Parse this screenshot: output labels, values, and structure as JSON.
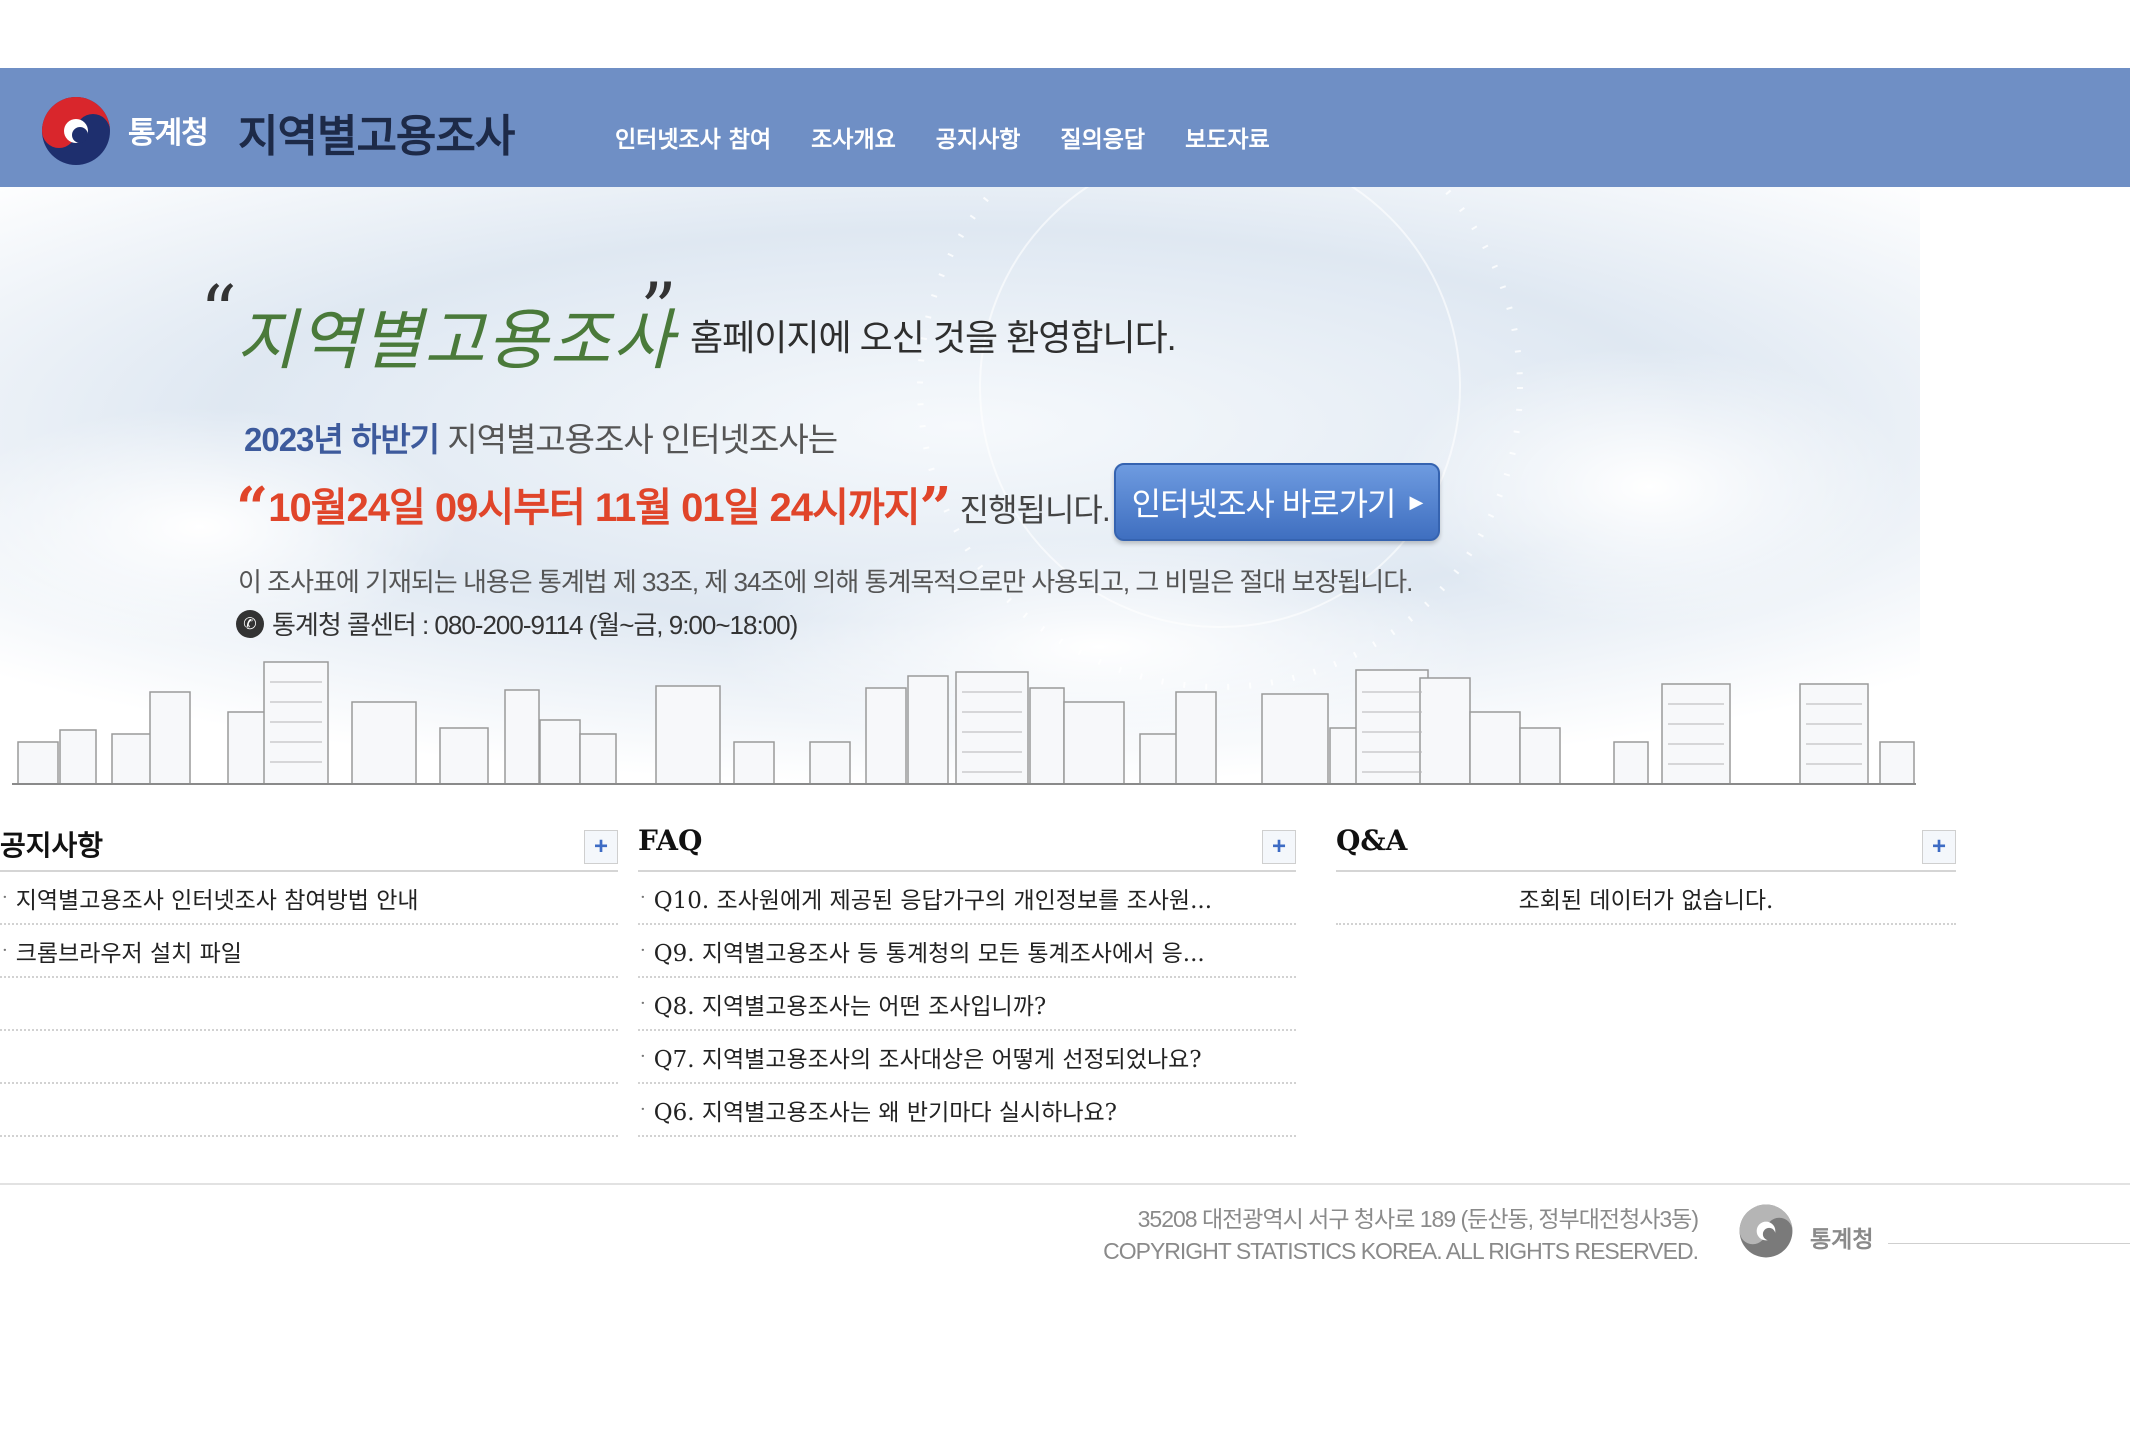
{
  "header": {
    "org_name": "통계청",
    "site_title": "지역별고용조사",
    "nav": [
      "인터넷조사 참여",
      "조사개요",
      "공지사항",
      "질의응답",
      "보도자료"
    ]
  },
  "banner": {
    "welcome_brand": "지역별고용조사",
    "welcome_text": "홈페이지에 오신 것을 환영합니다.",
    "period_year": "2023년",
    "period_half": "하반기",
    "period_rest": "지역별고용조사 인터넷조사는",
    "period_dates": "10월24일 09시부터  11월 01일 24시까지",
    "period_suffix": "진행됩니다.",
    "cta_label": "인터넷조사 바로가기",
    "legal": "이 조사표에 기재되는 내용은 통계법 제 33조, 제 34조에 의해 통계목적으로만 사용되고, 그 비밀은 절대 보장됩니다.",
    "callcenter": "통계청 콜센터 : 080-200-9114 (월~금, 9:00~18:00)"
  },
  "notice": {
    "title": "공지사항",
    "items": [
      "지역별고용조사 인터넷조사 참여방법 안내",
      "크롬브라우저 설치 파일"
    ]
  },
  "faq": {
    "title": "FAQ",
    "items": [
      "Q10. 조사원에게 제공된 응답가구의 개인정보를 조사원...",
      "Q9. 지역별고용조사 등 통계청의 모든 통계조사에서 응...",
      "Q8. 지역별고용조사는 어떤 조사입니까?",
      "Q7. 지역별고용조사의 조사대상은 어떻게 선정되었나요?",
      "Q6. 지역별고용조사는 왜 반기마다 실시하나요?"
    ]
  },
  "qna": {
    "title": "Q&A",
    "empty": "조회된 데이터가 없습니다."
  },
  "footer": {
    "address": "35208 대전광역시 서구 청사로 189 (둔산동, 정부대전청사3동)",
    "copyright": "COPYRIGHT STATISTICS KOREA. ALL RIGHTS RESERVED.",
    "org_name": "통계청"
  },
  "colors": {
    "header_bg": "#6f8fc5",
    "accent_red": "#e0452a",
    "accent_blue": "#3d5a9c"
  },
  "icons": {
    "more": "plus-icon",
    "phone": "phone-icon",
    "logo": "taeguk-logo-icon"
  }
}
